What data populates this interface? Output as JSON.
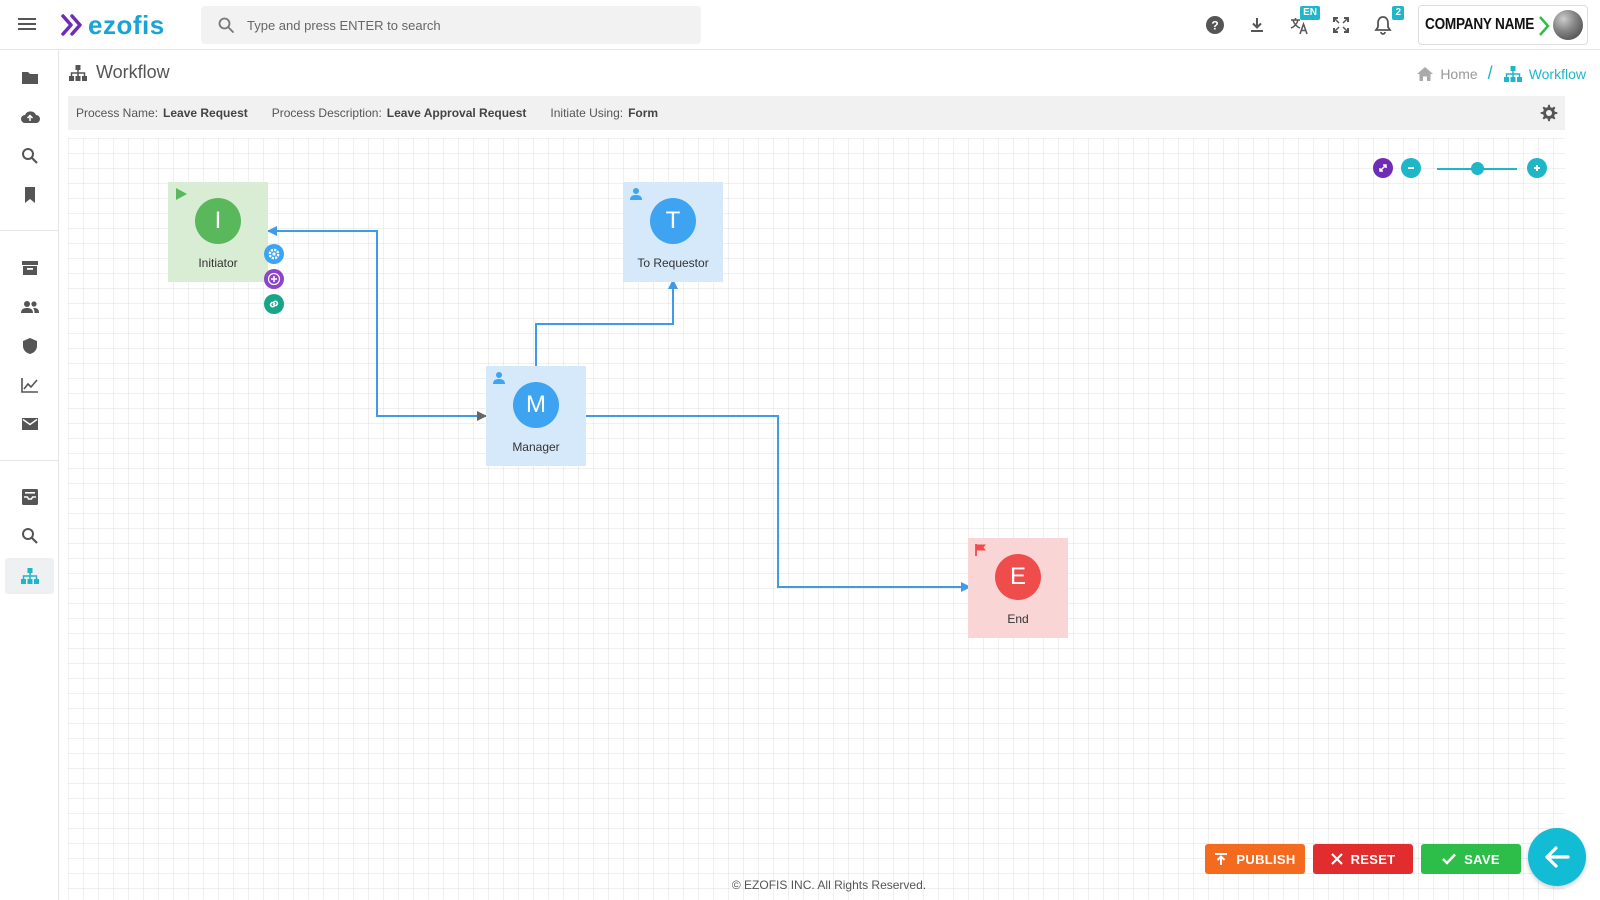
{
  "app": {
    "logo_text": "ezofis",
    "company_name": "COMPANY NAME"
  },
  "search": {
    "placeholder": "Type and press ENTER to search"
  },
  "header_icons": [
    {
      "name": "help-icon"
    },
    {
      "name": "download-icon"
    },
    {
      "name": "translate-icon",
      "badge": "EN"
    },
    {
      "name": "fullscreen-icon"
    },
    {
      "name": "notification-bell-icon",
      "badge": "2"
    }
  ],
  "sidebar": {
    "items": [
      {
        "name": "folders-icon"
      },
      {
        "name": "cloud-upload-icon"
      },
      {
        "name": "search-icon"
      },
      {
        "name": "bookmark-icon"
      },
      {
        "name": "archive-icon"
      },
      {
        "name": "users-icon"
      },
      {
        "name": "shield-icon"
      },
      {
        "name": "chart-icon"
      },
      {
        "name": "mail-icon"
      },
      {
        "name": "inbox-icon"
      },
      {
        "name": "search-icon"
      },
      {
        "name": "workflow-icon",
        "active": true
      }
    ]
  },
  "page": {
    "title": "Workflow"
  },
  "breadcrumb": {
    "home": "Home",
    "current": "Workflow"
  },
  "process": {
    "name_label": "Process Name:",
    "name": "Leave Request",
    "description_label": "Process Description:",
    "description": "Leave Approval Request",
    "initiate_label": "Initiate Using:",
    "initiate": "Form"
  },
  "workflow": {
    "nodes": [
      {
        "id": "initiator",
        "letter": "I",
        "label": "Initiator",
        "kind": "start",
        "color": "#59b85c"
      },
      {
        "id": "to-requestor",
        "letter": "T",
        "label": "To Requestor",
        "kind": "user",
        "color": "#3ea4f1"
      },
      {
        "id": "manager",
        "letter": "M",
        "label": "Manager",
        "kind": "user",
        "color": "#3ea4f1"
      },
      {
        "id": "end",
        "letter": "E",
        "label": "End",
        "kind": "end",
        "color": "#ef4c4c"
      }
    ],
    "connections": [
      {
        "from": "initiator",
        "to": "manager"
      },
      {
        "from": "manager",
        "to": "initiator"
      },
      {
        "from": "manager",
        "to": "to-requestor"
      },
      {
        "from": "manager",
        "to": "end"
      }
    ],
    "node_actions": [
      "settings-icon",
      "add-icon",
      "link-icon"
    ]
  },
  "zoom": {
    "level": 0.5
  },
  "actions": {
    "publish": "PUBLISH",
    "reset": "RESET",
    "save": "SAVE"
  },
  "footer": {
    "copyright": "© EZOFIS INC. All Rights Reserved."
  },
  "colors": {
    "accent": "#1fb6c9",
    "publish": "#f46a1f",
    "reset": "#e12d2d",
    "save": "#2dbe4a",
    "brand_purple": "#6f2db5",
    "brand_blue": "#1aa3d6"
  }
}
